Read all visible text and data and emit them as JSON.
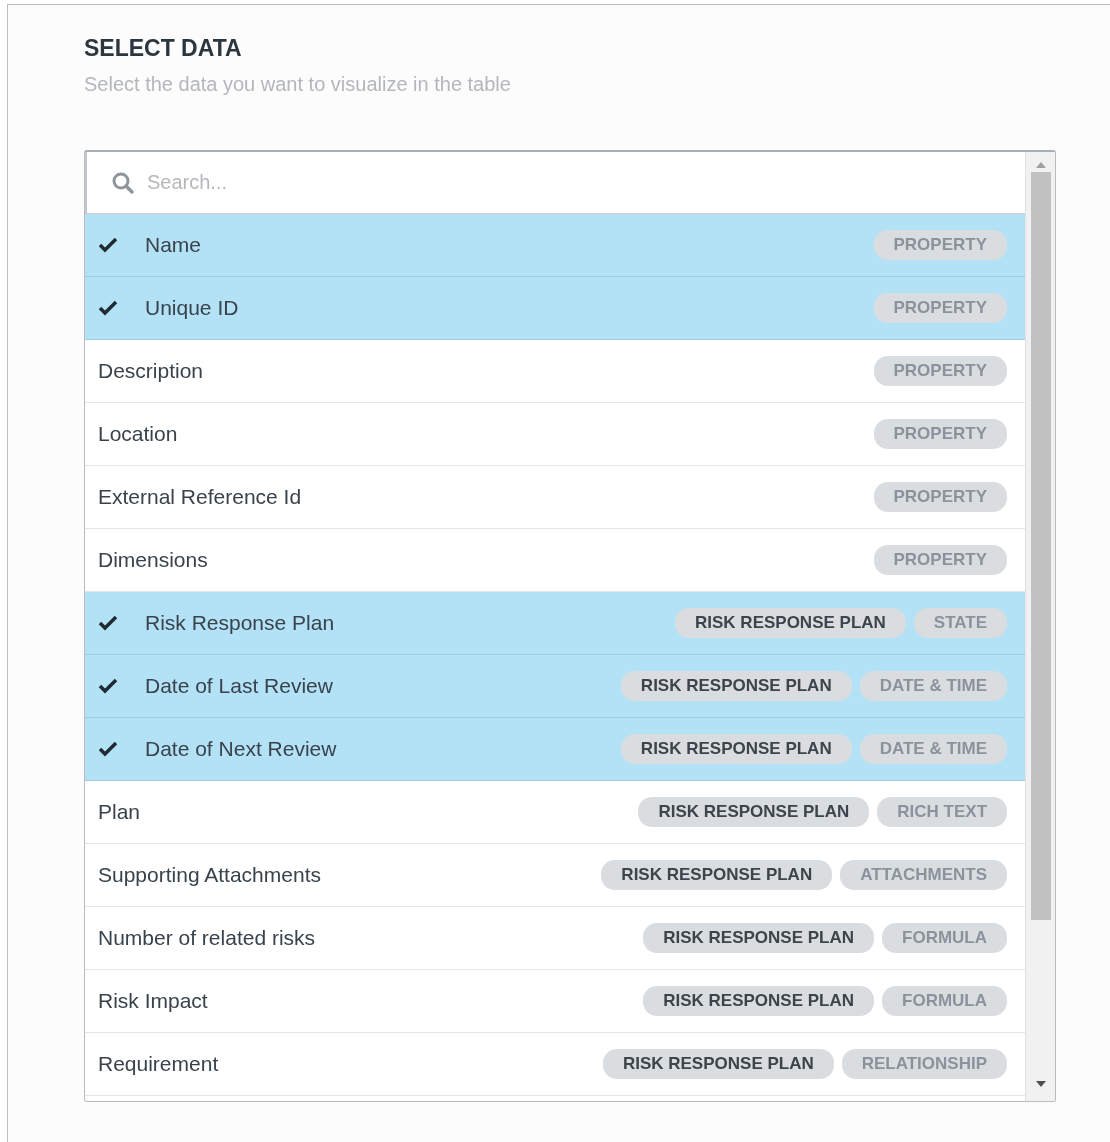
{
  "header": {
    "title": "SELECT DATA",
    "subtitle": "Select the data you want to visualize in the table"
  },
  "search": {
    "placeholder": "Search..."
  },
  "items": [
    {
      "label": "Name",
      "selected": true,
      "tags": [
        {
          "kind": "type",
          "text": "PROPERTY"
        }
      ]
    },
    {
      "label": "Unique ID",
      "selected": true,
      "tags": [
        {
          "kind": "type",
          "text": "PROPERTY"
        }
      ]
    },
    {
      "label": "Description",
      "selected": false,
      "tags": [
        {
          "kind": "type",
          "text": "PROPERTY"
        }
      ]
    },
    {
      "label": "Location",
      "selected": false,
      "tags": [
        {
          "kind": "type",
          "text": "PROPERTY"
        }
      ]
    },
    {
      "label": "External Reference Id",
      "selected": false,
      "tags": [
        {
          "kind": "type",
          "text": "PROPERTY"
        }
      ]
    },
    {
      "label": "Dimensions",
      "selected": false,
      "tags": [
        {
          "kind": "type",
          "text": "PROPERTY"
        }
      ]
    },
    {
      "label": "Risk Response Plan",
      "selected": true,
      "tags": [
        {
          "kind": "source",
          "text": "RISK RESPONSE PLAN"
        },
        {
          "kind": "type",
          "text": "STATE"
        }
      ]
    },
    {
      "label": "Date of Last Review",
      "selected": true,
      "tags": [
        {
          "kind": "source",
          "text": "RISK RESPONSE PLAN"
        },
        {
          "kind": "type",
          "text": "DATE & TIME"
        }
      ]
    },
    {
      "label": "Date of Next Review",
      "selected": true,
      "tags": [
        {
          "kind": "source",
          "text": "RISK RESPONSE PLAN"
        },
        {
          "kind": "type",
          "text": "DATE & TIME"
        }
      ]
    },
    {
      "label": "Plan",
      "selected": false,
      "tags": [
        {
          "kind": "source",
          "text": "RISK RESPONSE PLAN"
        },
        {
          "kind": "type",
          "text": "RICH TEXT"
        }
      ]
    },
    {
      "label": "Supporting Attachments",
      "selected": false,
      "tags": [
        {
          "kind": "source",
          "text": "RISK RESPONSE PLAN"
        },
        {
          "kind": "type",
          "text": "ATTACHMENTS"
        }
      ]
    },
    {
      "label": "Number of related risks",
      "selected": false,
      "tags": [
        {
          "kind": "source",
          "text": "RISK RESPONSE PLAN"
        },
        {
          "kind": "type",
          "text": "FORMULA"
        }
      ]
    },
    {
      "label": "Risk Impact",
      "selected": false,
      "tags": [
        {
          "kind": "source",
          "text": "RISK RESPONSE PLAN"
        },
        {
          "kind": "type",
          "text": "FORMULA"
        }
      ]
    },
    {
      "label": "Requirement",
      "selected": false,
      "tags": [
        {
          "kind": "source",
          "text": "RISK RESPONSE PLAN"
        },
        {
          "kind": "type",
          "text": "RELATIONSHIP"
        }
      ]
    }
  ]
}
